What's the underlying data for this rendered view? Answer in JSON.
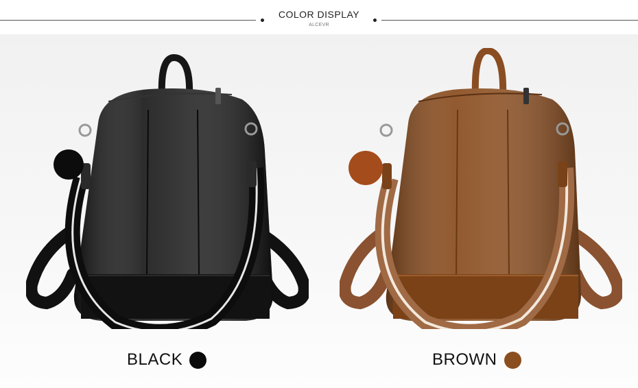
{
  "header": {
    "title": "COLOR DISPLAY",
    "subtitle": "ALCEVR"
  },
  "variants": [
    {
      "label": "BLACK",
      "swatch_color": "#0a0a0a"
    },
    {
      "label": "BROWN",
      "swatch_color": "#8b4e1f"
    }
  ]
}
